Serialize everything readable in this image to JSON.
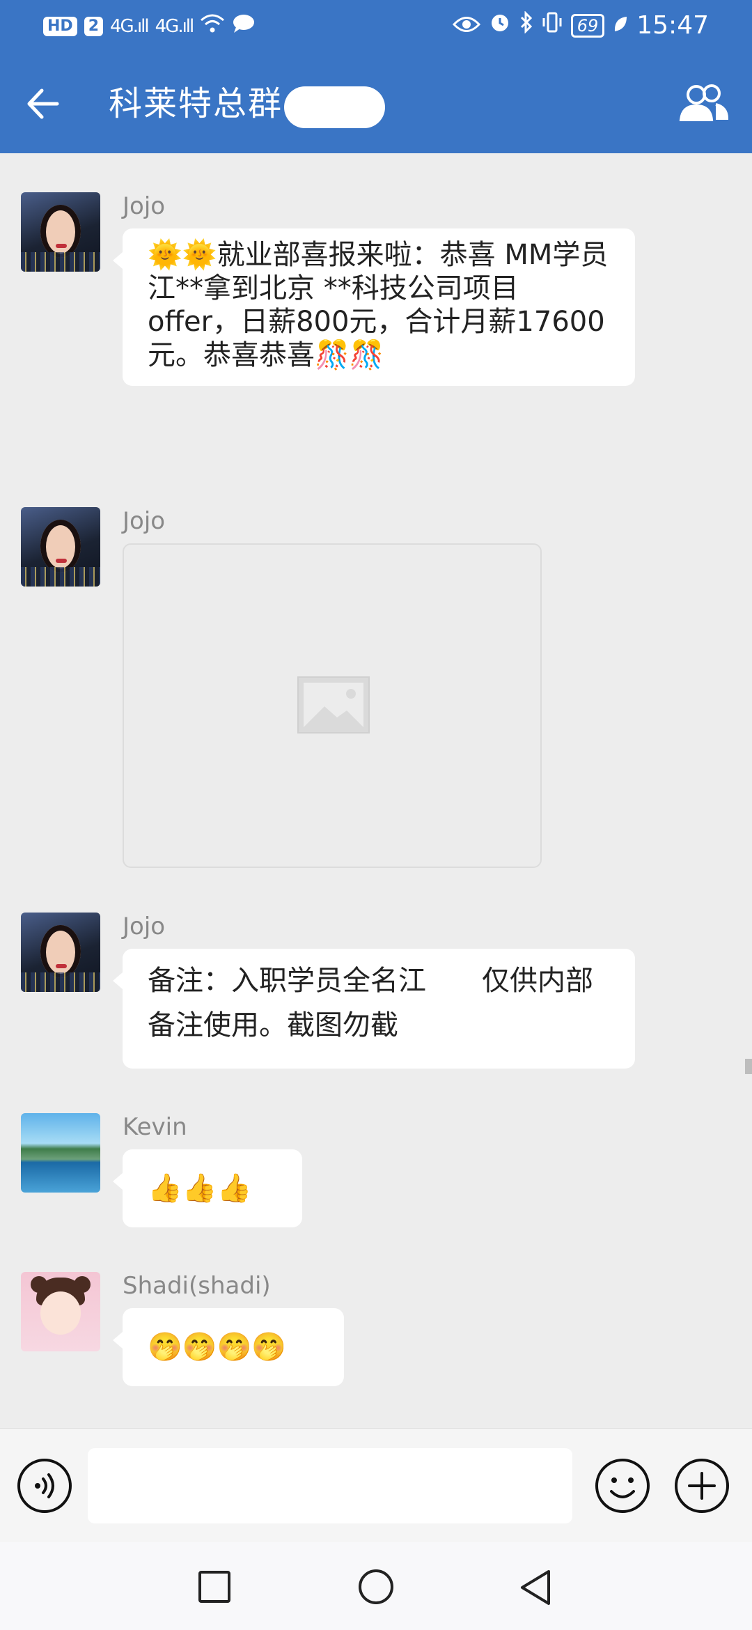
{
  "status_bar": {
    "left_badge_1": "HD",
    "left_badge_2": "2",
    "signal_1": "4G.ıll",
    "signal_2": "4G.ıll",
    "wifi": "wifi-icon",
    "chat_icon": "message-icon",
    "battery": "69",
    "time": "15:47"
  },
  "header": {
    "title": "科莱特总群",
    "back_icon": "arrow-left-icon",
    "members_icon": "group-members-icon"
  },
  "messages": [
    {
      "sender": "Jojo",
      "text": "🌞🌞就业部喜报来啦：恭喜 MM学员江**拿到北京 **科技公司项目offer，日薪800元，合计月薪17600元。恭喜恭喜🎊🎊"
    },
    {
      "sender": "Jojo",
      "image": "image-placeholder-icon"
    },
    {
      "sender": "Jojo",
      "text": "备注：入职学员全名江　　仅供内部备注使用。截图勿截"
    },
    {
      "sender": "Kevin",
      "text": "👍👍👍"
    },
    {
      "sender": "Shadi(shadi)",
      "text": "🤭🤭🤭🤭"
    }
  ],
  "input_bar": {
    "text_value": "",
    "voice_icon": "voice-icon",
    "emoji_icon": "emoji-icon",
    "plus_icon": "plus-icon"
  },
  "nav_bar": {
    "recent_icon": "square-icon",
    "home_icon": "circle-icon",
    "back_icon": "triangle-back-icon"
  },
  "colors": {
    "header": "#3a75c5",
    "chat_bg": "#ededed",
    "bubble": "#ffffff"
  }
}
